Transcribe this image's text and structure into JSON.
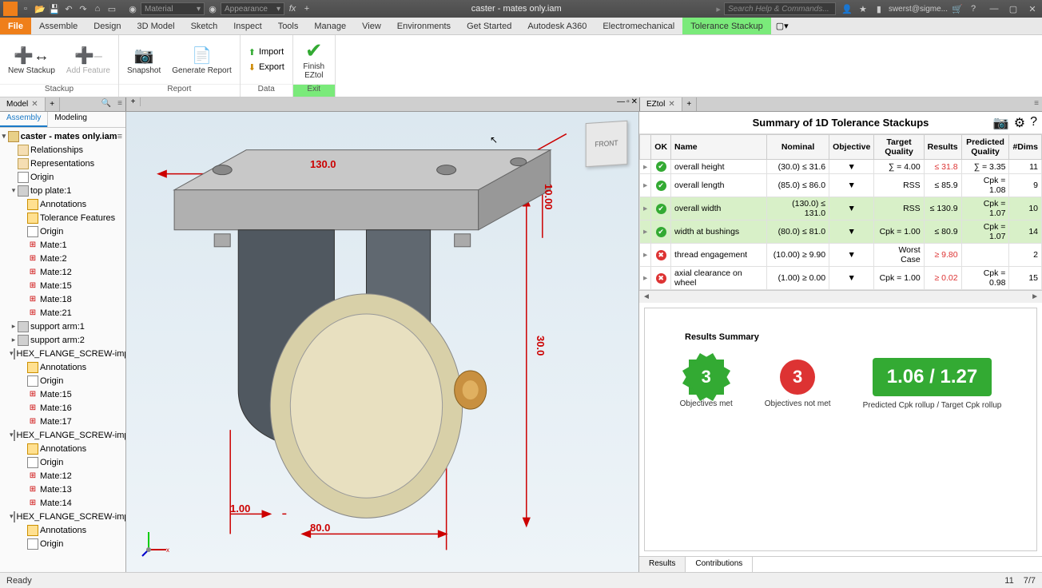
{
  "titlebar": {
    "doc_title": "caster - mates only.iam",
    "combo1": "Material",
    "combo2": "Appearance",
    "search_placeholder": "Search Help & Commands...",
    "user": "swerst@sigme..."
  },
  "menu": {
    "tabs": [
      "File",
      "Assemble",
      "Design",
      "3D Model",
      "Sketch",
      "Inspect",
      "Tools",
      "Manage",
      "View",
      "Environments",
      "Get Started",
      "Autodesk A360",
      "Electromechanical",
      "Tolerance Stackup"
    ],
    "active": "Tolerance Stackup"
  },
  "ribbon": {
    "stackup": {
      "new": "New Stackup",
      "add": "Add Feature",
      "group": "Stackup"
    },
    "report": {
      "snapshot": "Snapshot",
      "generate": "Generate Report",
      "group": "Report"
    },
    "data": {
      "import": "Import",
      "export": "Export",
      "group": "Data"
    },
    "exit": {
      "finish": "Finish\nEZtol",
      "group": "Exit"
    }
  },
  "doctabs": {
    "left": "Model",
    "right": "EZtol"
  },
  "browser": {
    "tabs": {
      "assembly": "Assembly",
      "modeling": "Modeling"
    },
    "root": "caster - mates only.iam",
    "nodes": [
      {
        "l": 1,
        "t": "fold",
        "n": "Relationships"
      },
      {
        "l": 1,
        "t": "fold",
        "n": "Representations"
      },
      {
        "l": 1,
        "t": "orig",
        "n": "Origin"
      },
      {
        "l": 1,
        "t": "part",
        "n": "top plate:1",
        "exp": "-"
      },
      {
        "l": 2,
        "t": "ann",
        "n": "Annotations"
      },
      {
        "l": 2,
        "t": "ann",
        "n": "Tolerance Features"
      },
      {
        "l": 2,
        "t": "orig",
        "n": "Origin"
      },
      {
        "l": 2,
        "t": "mate",
        "n": "Mate:1"
      },
      {
        "l": 2,
        "t": "mate",
        "n": "Mate:2"
      },
      {
        "l": 2,
        "t": "mate",
        "n": "Mate:12"
      },
      {
        "l": 2,
        "t": "mate",
        "n": "Mate:15"
      },
      {
        "l": 2,
        "t": "mate",
        "n": "Mate:18"
      },
      {
        "l": 2,
        "t": "mate",
        "n": "Mate:21"
      },
      {
        "l": 1,
        "t": "part",
        "n": "support arm:1",
        "exp": "+"
      },
      {
        "l": 1,
        "t": "part",
        "n": "support arm:2",
        "exp": "+"
      },
      {
        "l": 1,
        "t": "part",
        "n": "HEX_FLANGE_SCREW-impor",
        "exp": "-"
      },
      {
        "l": 2,
        "t": "ann",
        "n": "Annotations"
      },
      {
        "l": 2,
        "t": "orig",
        "n": "Origin"
      },
      {
        "l": 2,
        "t": "mate",
        "n": "Mate:15"
      },
      {
        "l": 2,
        "t": "mate",
        "n": "Mate:16"
      },
      {
        "l": 2,
        "t": "mate",
        "n": "Mate:17"
      },
      {
        "l": 1,
        "t": "part",
        "n": "HEX_FLANGE_SCREW-impor",
        "exp": "-"
      },
      {
        "l": 2,
        "t": "ann",
        "n": "Annotations"
      },
      {
        "l": 2,
        "t": "orig",
        "n": "Origin"
      },
      {
        "l": 2,
        "t": "mate",
        "n": "Mate:12"
      },
      {
        "l": 2,
        "t": "mate",
        "n": "Mate:13"
      },
      {
        "l": 2,
        "t": "mate",
        "n": "Mate:14"
      },
      {
        "l": 1,
        "t": "part",
        "n": "HEX_FLANGE_SCREW-impor",
        "exp": "-"
      },
      {
        "l": 2,
        "t": "ann",
        "n": "Annotations"
      },
      {
        "l": 2,
        "t": "orig",
        "n": "Origin"
      }
    ]
  },
  "viewport": {
    "viewcube": "FRONT",
    "dims": {
      "d130": "130.0",
      "d80": "80.0",
      "d30": "30.0",
      "d10": "10.00",
      "d1": "1.00"
    }
  },
  "ezpanel": {
    "title": "Summary of 1D Tolerance Stackups",
    "headers": {
      "ok": "OK",
      "name": "Name",
      "nominal": "Nominal",
      "objective": "Objective",
      "tq": "Target\nQuality",
      "results": "Results",
      "pq": "Predicted\nQuality",
      "dims": "#Dims"
    },
    "rows": [
      {
        "ok": "ok",
        "name": "overall height",
        "nom": "(30.0) ≤ 31.6",
        "obj": "▼",
        "tq": "∑ = 4.00",
        "res": "≤ 31.8",
        "res_bad": true,
        "pq": "∑ = 3.35",
        "dims": "11"
      },
      {
        "ok": "ok",
        "name": "overall length",
        "nom": "(85.0) ≤ 86.0",
        "obj": "▼",
        "tq": "RSS",
        "res": "≤ 85.9",
        "pq": "Cpk = 1.08",
        "dims": "9"
      },
      {
        "ok": "ok",
        "name": "overall width",
        "nom": "(130.0) ≤ 131.0",
        "obj": "▼",
        "tq": "RSS",
        "res": "≤ 130.9",
        "pq": "Cpk = 1.07",
        "dims": "10",
        "sel": true
      },
      {
        "ok": "ok",
        "name": "width at bushings",
        "nom": "(80.0) ≤ 81.0",
        "obj": "▼",
        "tq": "Cpk = 1.00",
        "res": "≤ 80.9",
        "pq": "Cpk = 1.07",
        "dims": "14",
        "sel": true
      },
      {
        "ok": "bad",
        "name": "thread engagement",
        "nom": "(10.00) ≥ 9.90",
        "obj": "▼",
        "tq": "Worst Case",
        "res": "≥ 9.80",
        "res_bad": true,
        "pq": "",
        "dims": "2"
      },
      {
        "ok": "bad",
        "name": "axial clearance on wheel",
        "nom": "(1.00) ≥ 0.00",
        "obj": "▼",
        "tq": "Cpk = 1.00",
        "res": "≥ 0.02",
        "res_bad": true,
        "pq": "Cpk = 0.98",
        "dims": "15"
      }
    ],
    "summary": {
      "title": "Results Summary",
      "met_n": "3",
      "met_l": "Objectives met",
      "notmet_n": "3",
      "notmet_l": "Objectives not met",
      "cpk": "1.06 / 1.27",
      "cpk_l": "Predicted Cpk rollup / Target Cpk rollup"
    },
    "btabs": {
      "results": "Results",
      "contrib": "Contributions"
    }
  },
  "status": {
    "left": "Ready",
    "n": "11",
    "page": "7/7"
  }
}
